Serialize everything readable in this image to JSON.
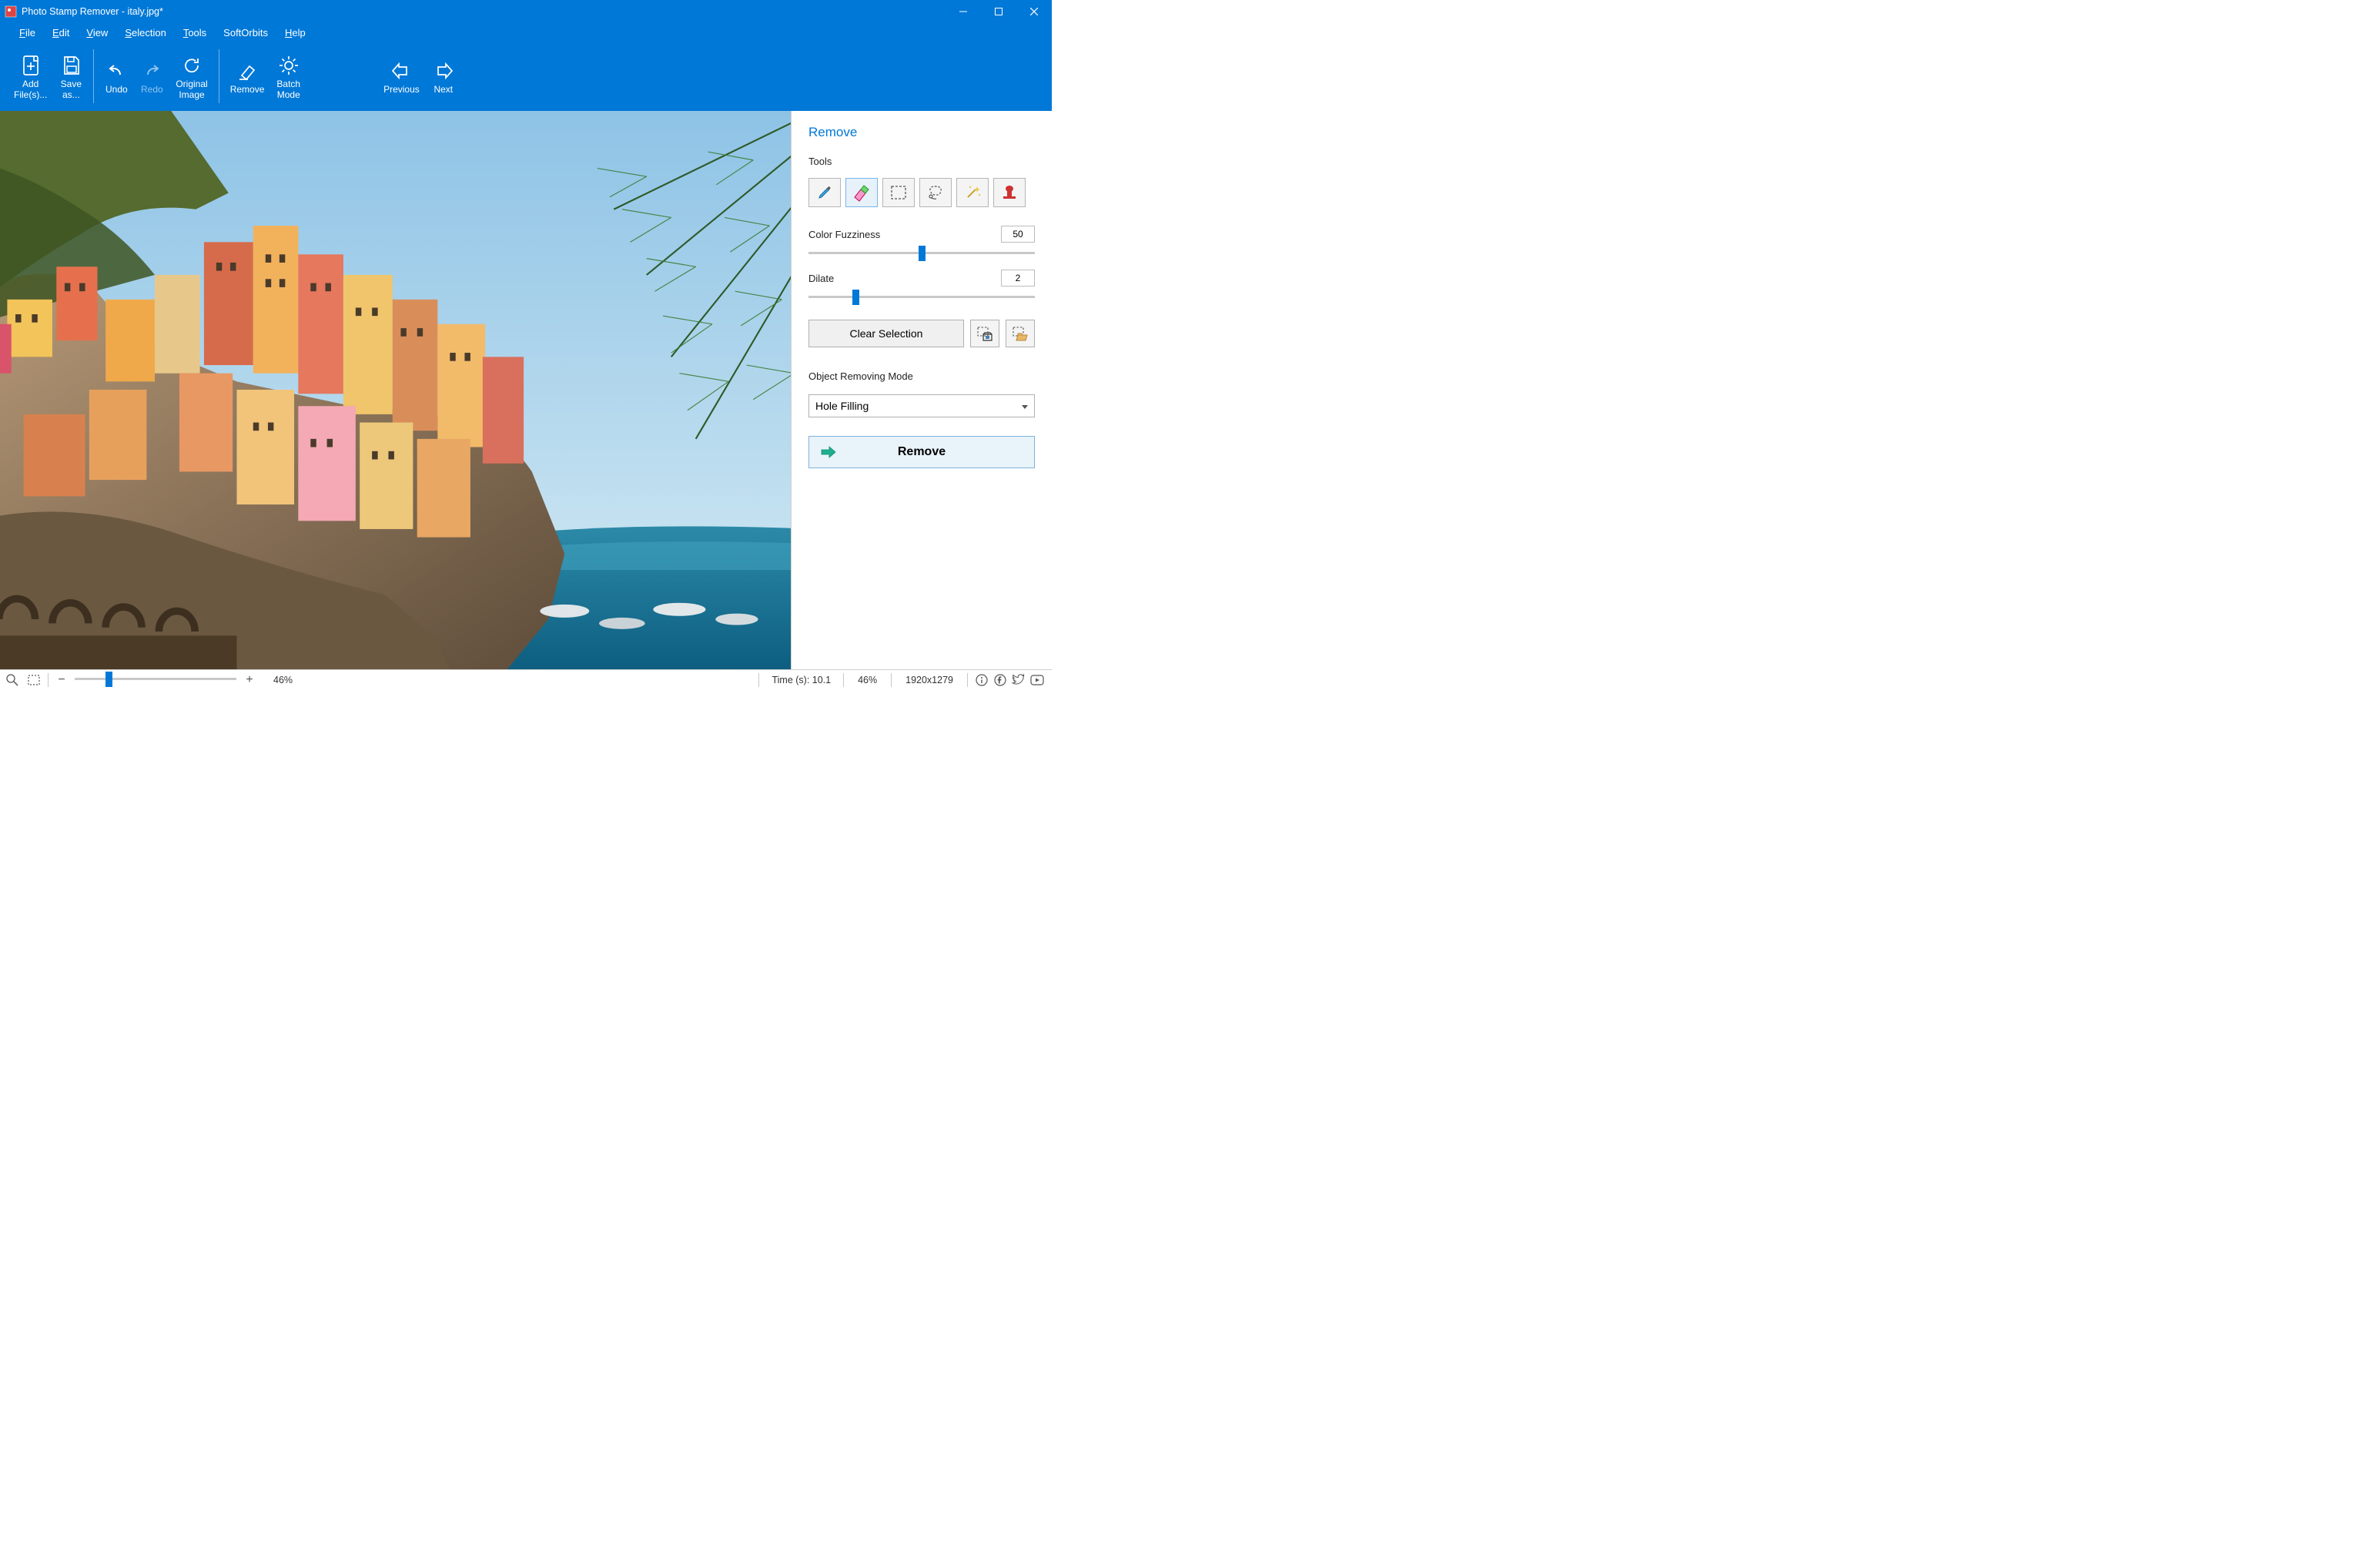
{
  "title": "Photo Stamp Remover - italy.jpg*",
  "menu": {
    "file": "File",
    "edit": "Edit",
    "view": "View",
    "selection": "Selection",
    "tools": "Tools",
    "softorbits": "SoftOrbits",
    "help": "Help"
  },
  "toolbar": {
    "add_files": "Add\nFile(s)...",
    "save_as": "Save\nas...",
    "undo": "Undo",
    "redo": "Redo",
    "original_image": "Original\nImage",
    "remove": "Remove",
    "batch_mode": "Batch\nMode",
    "previous": "Previous",
    "next": "Next"
  },
  "panel": {
    "title": "Remove",
    "tools_label": "Tools",
    "color_fuzziness_label": "Color Fuzziness",
    "color_fuzziness_value": "50",
    "dilate_label": "Dilate",
    "dilate_value": "2",
    "clear_selection": "Clear Selection",
    "object_removing_mode_label": "Object Removing Mode",
    "mode_selected": "Hole Filling",
    "remove_button": "Remove"
  },
  "status": {
    "zoom_pct": "46%",
    "time_label": "Time (s): 10.1",
    "zoom_pct_right": "46%",
    "dimensions": "1920x1279"
  }
}
